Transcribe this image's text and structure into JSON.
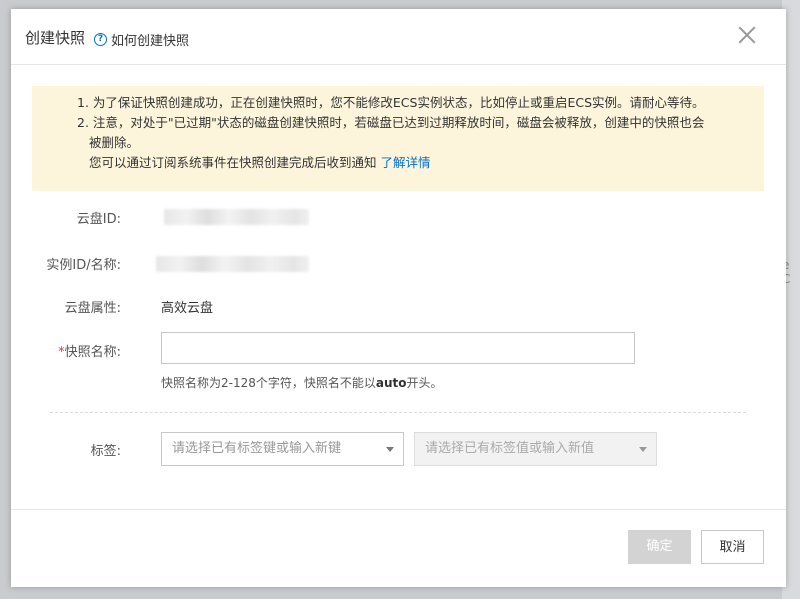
{
  "dialog": {
    "title": "创建快照",
    "help_link": "如何创建快照",
    "help_icon": "question-circle-icon",
    "close_icon": "close-icon"
  },
  "notice": {
    "line1": "1. 为了保证快照创建成功，正在创建快照时，您不能修改ECS实例状态，比如停止或重启ECS实例。请耐心等待。",
    "line2": "2. 注意，对处于\"已过期\"状态的磁盘创建快照时，若磁盘已达到过期释放时间，磁盘会被释放，创建中的快照也会",
    "line3": "被删除。",
    "line4_text": "您可以通过订阅系统事件在快照创建完成后收到通知",
    "line4_link": "了解详情"
  },
  "form": {
    "disk_id_label": "云盘ID:",
    "instance_label": "实例ID/名称:",
    "disk_attr_label": "云盘属性:",
    "disk_attr_value": "高效云盘",
    "snapshot_name_required": "*",
    "snapshot_name_label": "快照名称:",
    "snapshot_name_value": "",
    "hint_prefix": "快照名称为2-128个字符，快照名不能以",
    "hint_bold": "auto",
    "hint_suffix": "开头。",
    "tag_label": "标签:",
    "tag_key_placeholder": "请选择已有标签键或输入新键",
    "tag_value_placeholder": "请选择已有标签值或输入新值"
  },
  "footer": {
    "ok_label": "确定",
    "cancel_label": "取消"
  },
  "backdrop": {
    "ghost_text": "e C"
  },
  "colors": {
    "link": "#0070cc",
    "notice_bg": "#fcf5dc",
    "required": "#e13c28",
    "disabled_button": "#d3d3d3"
  }
}
